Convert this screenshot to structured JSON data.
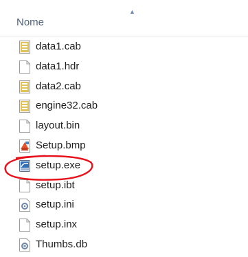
{
  "header": {
    "column_label": "Nome",
    "sort_indicator": "▲"
  },
  "files": [
    {
      "name": "data1.cab",
      "icon": "cab-archive-icon"
    },
    {
      "name": "data1.hdr",
      "icon": "blank-file-icon"
    },
    {
      "name": "data2.cab",
      "icon": "cab-archive-icon"
    },
    {
      "name": "engine32.cab",
      "icon": "cab-archive-icon"
    },
    {
      "name": "layout.bin",
      "icon": "blank-file-icon"
    },
    {
      "name": "Setup.bmp",
      "icon": "bitmap-image-icon"
    },
    {
      "name": "setup.exe",
      "icon": "installer-exe-icon"
    },
    {
      "name": "setup.ibt",
      "icon": "blank-file-icon"
    },
    {
      "name": "setup.ini",
      "icon": "config-settings-icon"
    },
    {
      "name": "setup.inx",
      "icon": "blank-file-icon"
    },
    {
      "name": "Thumbs.db",
      "icon": "thumbs-db-icon"
    }
  ],
  "annotation": {
    "highlighted_file": "setup.exe",
    "color": "#e8101a"
  }
}
